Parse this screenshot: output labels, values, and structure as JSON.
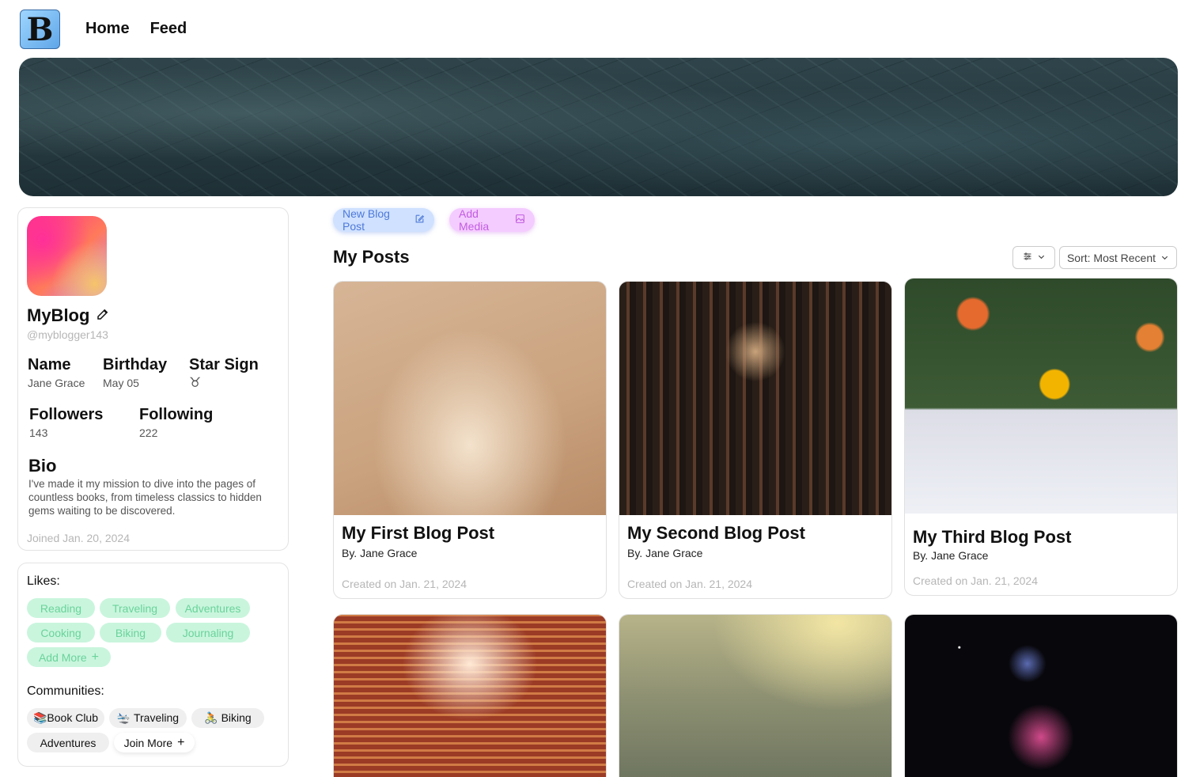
{
  "header": {
    "logo_letter": "B",
    "nav": [
      {
        "label": "Home"
      },
      {
        "label": "Feed"
      }
    ]
  },
  "profile": {
    "blog_name": "MyBlog",
    "handle": "@myblogger143",
    "name_label": "Name",
    "name_value": "Jane Grace",
    "birthday_label": "Birthday",
    "birthday_value": "May 05",
    "star_sign_label": "Star Sign",
    "star_sign_value": "♉",
    "followers_label": "Followers",
    "followers_value": "143",
    "following_label": "Following",
    "following_value": "222",
    "bio_label": "Bio",
    "bio_text": "I've made it my mission to dive into the pages of countless books, from timeless classics to hidden gems waiting to be discovered.",
    "joined": "Joined Jan. 20, 2024"
  },
  "likes": {
    "title": "Likes:",
    "items": [
      "Reading",
      "Traveling",
      "Adventures",
      "Cooking",
      "Biking",
      "Journaling"
    ],
    "add_more": "Add More"
  },
  "communities": {
    "title": "Communities:",
    "items": [
      "📚Book Club",
      "🛬 Traveling",
      "🚴 Biking",
      "Adventures"
    ],
    "join_more": "Join More"
  },
  "actions": {
    "new_post": "New Blog Post",
    "add_media": "Add Media"
  },
  "posts_section": {
    "title": "My Posts",
    "sort_label": "Sort: Most Recent"
  },
  "posts": [
    {
      "title": "My First Blog Post",
      "author": "By. Jane Grace",
      "date": "Created on Jan. 21, 2024"
    },
    {
      "title": "My Second Blog Post",
      "author": "By. Jane Grace",
      "date": "Created on Jan. 21, 2024"
    },
    {
      "title": "My Third Blog Post",
      "author": "By. Jane Grace",
      "date": "Created on Jan. 21, 2024"
    }
  ],
  "colors": {
    "like_pill_bg": "#c9f5dd",
    "like_pill_text": "#6ad39a",
    "new_post_bg": "#cfe1ff",
    "add_media_bg": "#f4ccff"
  }
}
